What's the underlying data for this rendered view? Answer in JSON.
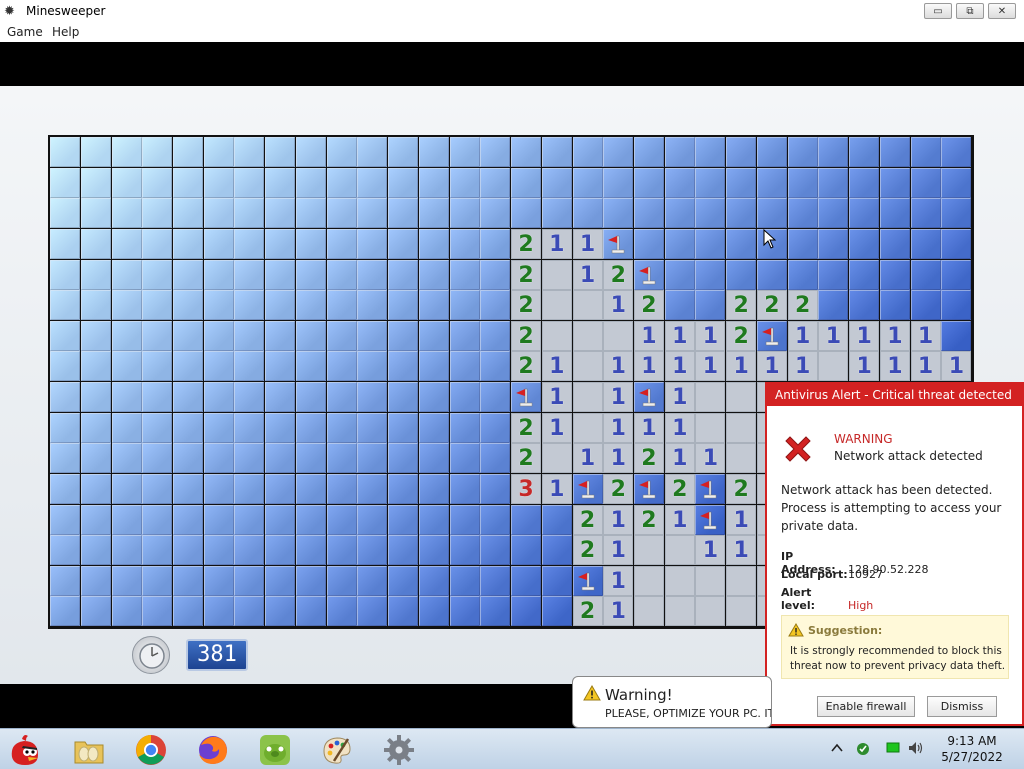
{
  "window": {
    "title": "Minesweeper",
    "minimize": "▭",
    "restore": "⧉",
    "close": "✕"
  },
  "menu": [
    "Game",
    "Help"
  ],
  "timer": {
    "value": "381"
  },
  "board": {
    "cols": 30,
    "rows": 16,
    "rowsData": [
      "..............................",
      "..............................",
      "..............................",
      "...............211F...........",
      "...............2 12F..........",
      "...............2  12..222.....",
      "...............2   1112F11111.",
      "...............21 1111111 1111",
      "...............F1 1F1         ",
      "...............21 111  11     ",
      "...............2 11211  1F    ",
      "...............31F2F2F2122    ",
      ".................2121F11.     ",
      ".................21  1111     ",
      ".................F1           ",
      ".................21           "
    ]
  },
  "colors": {
    "n1": "#3b4bb6",
    "n2": "#1f7a1f",
    "n3": "#c62828",
    "alertRed": "#d32222"
  },
  "alert": {
    "title": "Antivirus Alert - Critical threat detected",
    "warning": "WARNING",
    "warning_sub": "Network attack detected",
    "description": "Network attack has been detected. Process is attempting to access your private data.",
    "ip_label": "IP Address:",
    "ip_value": "128.90.52.228",
    "port_label": "Local port:",
    "port_value": "10927",
    "level_label": "Alert level:",
    "level_value": "High",
    "suggestion_title": "Suggestion:",
    "suggestion_text": "It is strongly recommended to block this threat now to prevent privacy data theft.",
    "enable_button": "Enable firewall",
    "dismiss_button": "Dismiss"
  },
  "toast": {
    "title": "Warning!",
    "message": "PLEASE, OPTIMIZE YOUR PC. IT"
  },
  "taskbar": {
    "icons": [
      "angry-birds-icon",
      "folder-icon",
      "chrome-icon",
      "firefox-icon",
      "bad-piggies-icon",
      "paint-icon",
      "gear-app-icon"
    ],
    "time": "9:13 AM",
    "date": "5/27/2022"
  }
}
